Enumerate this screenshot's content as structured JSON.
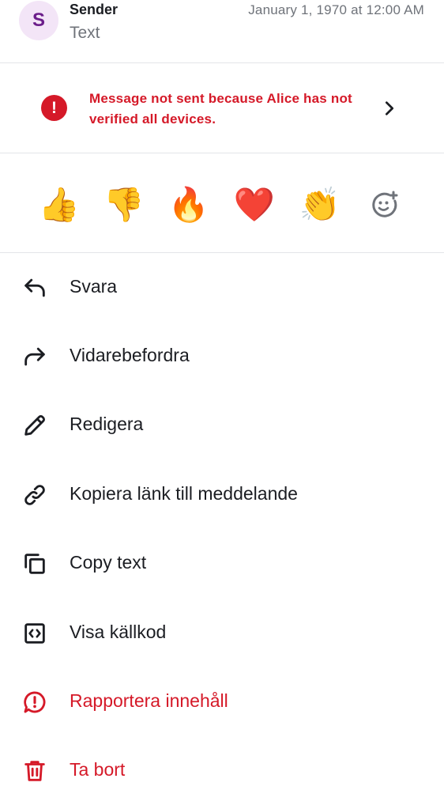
{
  "header": {
    "avatar_letter": "S",
    "sender": "Sender",
    "preview": "Text",
    "timestamp": "January 1, 1970 at 12:00 AM"
  },
  "warning": {
    "icon": "exclamation-circle-icon",
    "text": "Message not sent because Alice has not verified all devices."
  },
  "reactions": [
    {
      "emoji": "👍",
      "name": "thumbs-up"
    },
    {
      "emoji": "👎",
      "name": "thumbs-down"
    },
    {
      "emoji": "🔥",
      "name": "fire"
    },
    {
      "emoji": "❤️",
      "name": "red-heart"
    },
    {
      "emoji": "👏",
      "name": "clapping-hands"
    },
    {
      "name": "add-reaction",
      "icon": "smiley-plus-icon"
    }
  ],
  "menu": [
    {
      "label": "Svara",
      "icon": "reply-icon"
    },
    {
      "label": "Vidarebefordra",
      "icon": "forward-icon"
    },
    {
      "label": "Redigera",
      "icon": "pencil-icon"
    },
    {
      "label": "Kopiera länk till meddelande",
      "icon": "link-icon"
    },
    {
      "label": "Copy text",
      "icon": "copy-icon"
    },
    {
      "label": "Visa källkod",
      "icon": "code-icon"
    },
    {
      "label": "Rapportera innehåll",
      "icon": "report-icon"
    },
    {
      "label": "Ta bort",
      "icon": "trash-icon"
    }
  ],
  "colors": {
    "danger": "#d51928",
    "divider": "#e3e5e8",
    "secondary_text": "#6f737a",
    "avatar_bg": "#f3e5f7",
    "avatar_fg": "#6b1d8a"
  }
}
